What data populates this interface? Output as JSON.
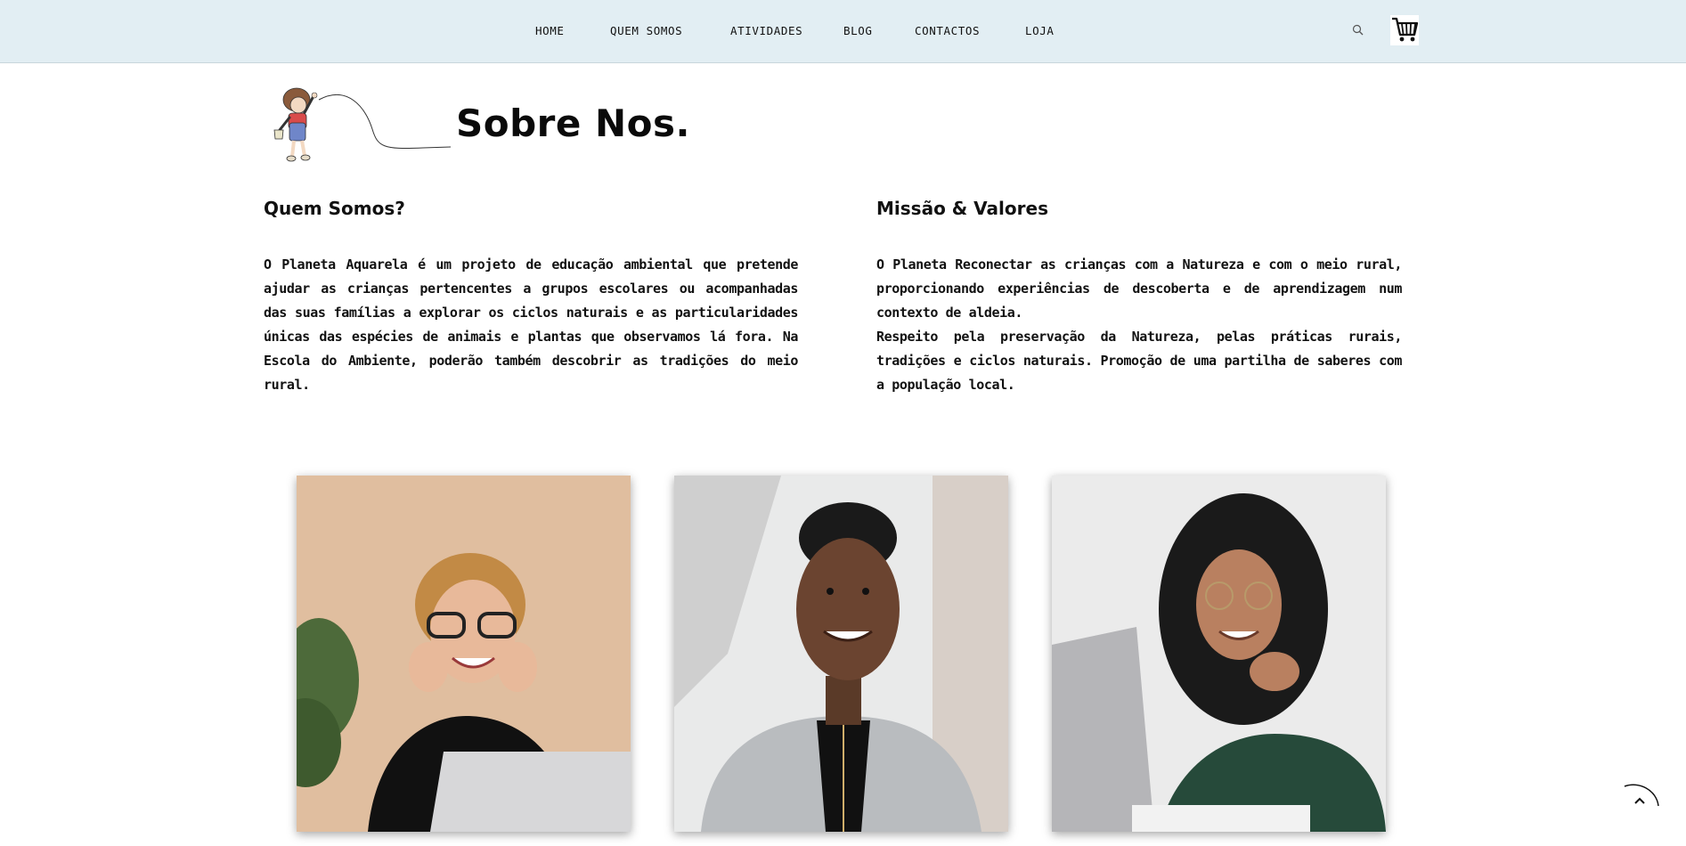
{
  "nav": {
    "items": [
      {
        "label": "HOME"
      },
      {
        "label": "QUEM SOMOS"
      },
      {
        "label": "ATIVIDADES"
      },
      {
        "label": "BLOG"
      },
      {
        "label": "CONTACTOS"
      },
      {
        "label": "LOJA"
      }
    ],
    "search_icon": "search-icon",
    "cart_icon": "shopping-cart-icon"
  },
  "page": {
    "title": "Sobre Nos.",
    "illustration": "child-with-kite-drawing"
  },
  "about": {
    "heading": "Quem Somos?",
    "body": "O Planeta Aquarela é um projeto de educação ambiental que pretende ajudar as crianças pertencentes a grupos escolares ou acompanhadas das suas famílias a explorar os ciclos naturais e as particularidades únicas das espécies de animais e plantas que observamos lá fora. Na Escola do Ambiente, poderão também descobrir as tradições do meio rural."
  },
  "mission": {
    "heading": "Missão & Valores",
    "line1": "O Planeta Reconectar as crianças com a Natureza e com o meio rural, proporcionando experiências de descoberta e de aprendizagem num contexto de aldeia.",
    "line2": "Respeito pela preservação da Natureza, pelas práticas rurais, tradições e ciclos naturais. Promoção de uma partilha de saberes com a população local."
  },
  "team": {
    "photos": [
      {
        "subject": "woman-with-glasses-laptop"
      },
      {
        "subject": "woman-in-grey-blazer"
      },
      {
        "subject": "woman-with-curly-hair-laptop"
      }
    ]
  },
  "colors": {
    "nav_bg": "#e2eef3",
    "text": "#111111"
  },
  "scroll_top_icon": "chevron-up-icon"
}
